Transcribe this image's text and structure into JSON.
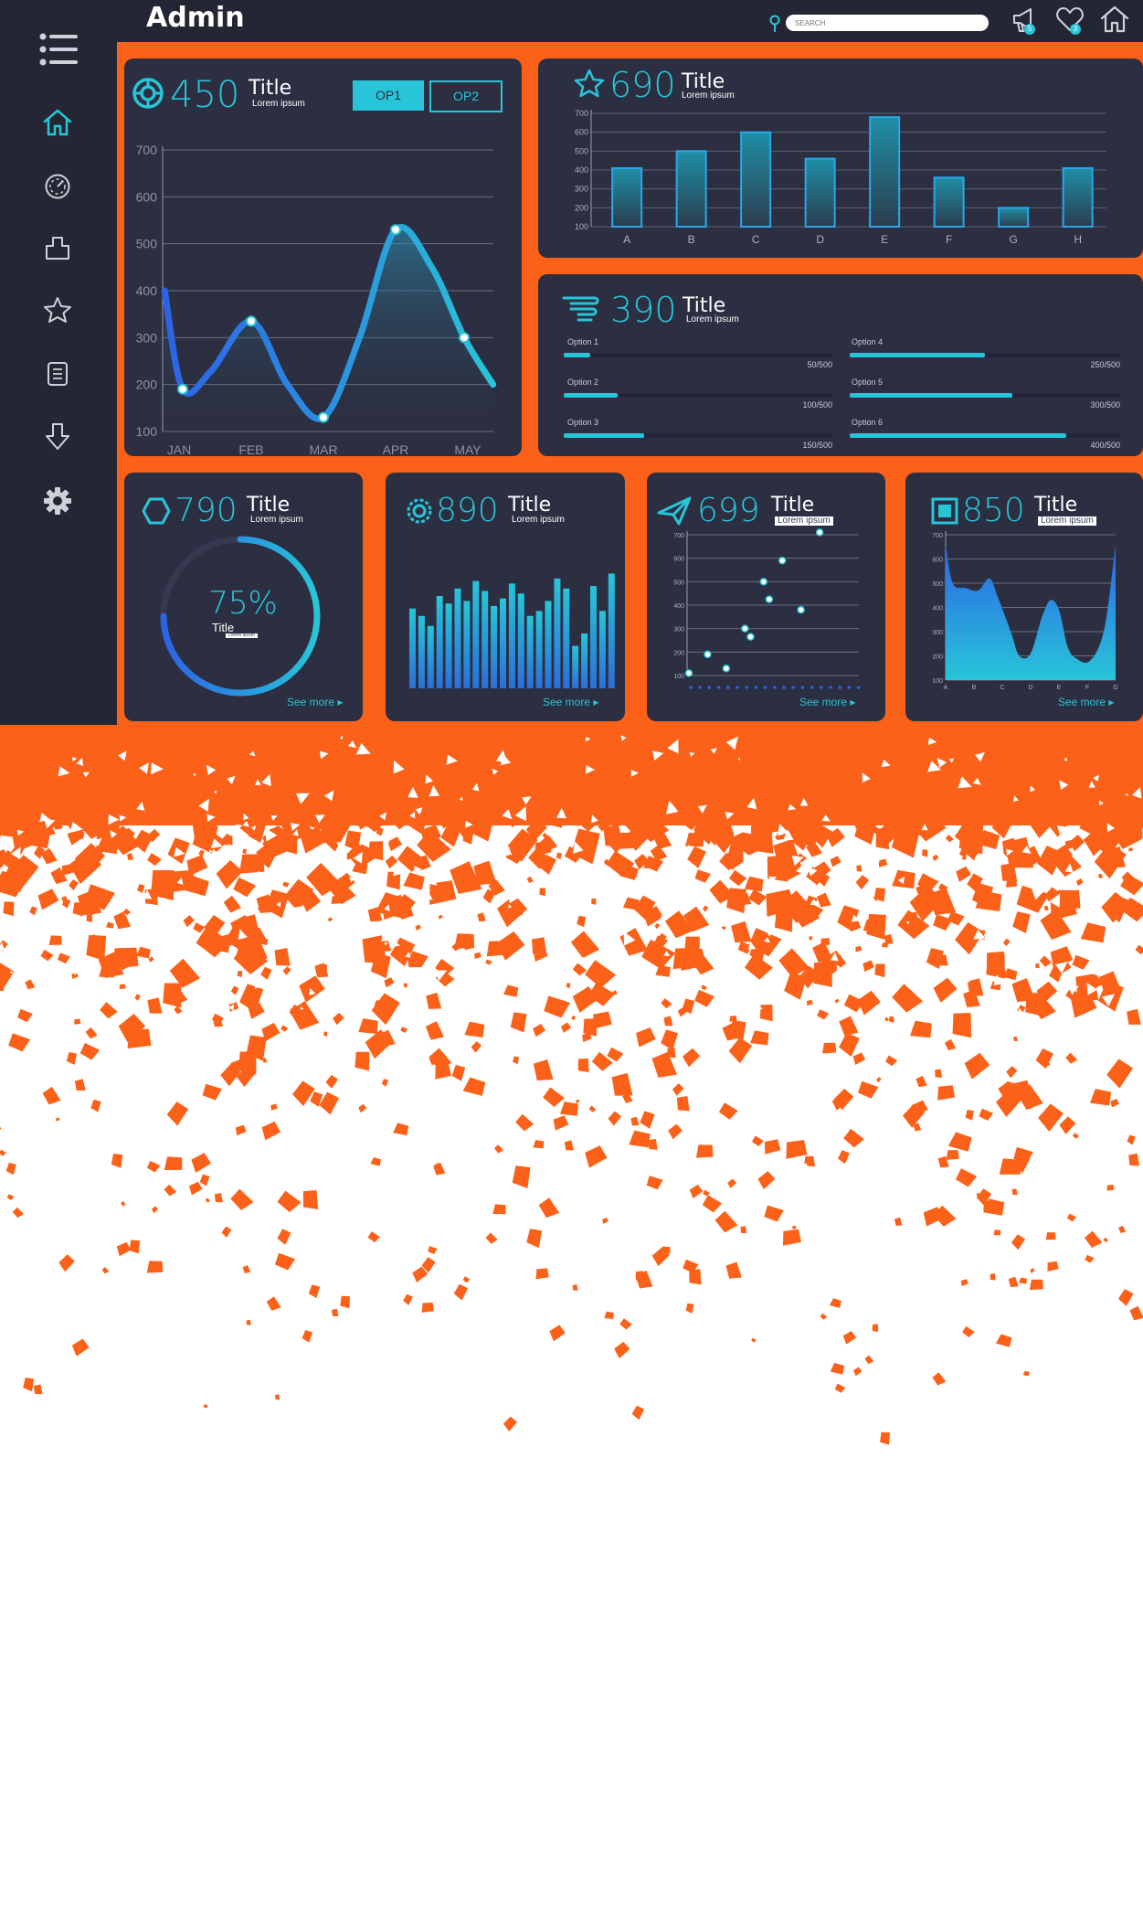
{
  "app": {
    "title": "Admin"
  },
  "colors": {
    "accent": "#28c5d8",
    "blue": "#2d63e6",
    "brand_orange": "#fb6118",
    "panel": "#2c2f42",
    "sidebar": "#242733"
  },
  "header": {
    "search_placeholder": "SEARCH",
    "icons": [
      "location-pin-icon",
      "megaphone-icon",
      "heart-icon",
      "home-icon"
    ],
    "notification_badges": [
      "5",
      "3"
    ]
  },
  "sidebar": {
    "menu_icon": "hamburger-menu-icon",
    "items": [
      {
        "icon": "home-icon",
        "active": true
      },
      {
        "icon": "dashboard-icon",
        "active": false
      },
      {
        "icon": "box-icon",
        "active": false
      },
      {
        "icon": "star-icon",
        "active": false
      },
      {
        "icon": "document-icon",
        "active": false
      },
      {
        "icon": "download-arrow-icon",
        "active": false
      },
      {
        "icon": "settings-gear-icon",
        "active": false
      }
    ]
  },
  "cards": {
    "line_card": {
      "value": "450",
      "title": "Title",
      "subtitle": "Lorem ipsum",
      "op1": "OP1",
      "op2": "OP2"
    },
    "bar_card": {
      "value": "690",
      "title": "Title",
      "subtitle": "Lorem ipsum"
    },
    "progress_card": {
      "value": "390",
      "title": "Title",
      "subtitle": "Lorem ipsum",
      "options": [
        {
          "label": "Option 1",
          "value": "50/500",
          "fraction": 0.1
        },
        {
          "label": "Option 2",
          "value": "100/500",
          "fraction": 0.2
        },
        {
          "label": "Option 3",
          "value": "150/500",
          "fraction": 0.3
        },
        {
          "label": "Option 4",
          "value": "250/500",
          "fraction": 0.5
        },
        {
          "label": "Option 5",
          "value": "300/500",
          "fraction": 0.6
        },
        {
          "label": "Option 6",
          "value": "400/500",
          "fraction": 0.8
        }
      ]
    },
    "donut_card": {
      "value": "790",
      "title": "Title",
      "subtitle": "Lorem ipsum",
      "percent_label": "75%",
      "inner_title": "Title",
      "inner_subtitle": "Lorem ipsum",
      "percent": 0.75,
      "see_more": "See more ▸"
    },
    "mini_bar_card": {
      "value": "890",
      "title": "Title",
      "subtitle": "Lorem ipsum",
      "see_more": "See more ▸"
    },
    "scatter_card": {
      "value": "699",
      "title": "Title",
      "subtitle": "Lorem ipsum",
      "see_more": "See more ▸"
    },
    "area_card": {
      "value": "850",
      "title": "Title",
      "subtitle": "Lorem ipsum",
      "see_more": "See more ▸"
    }
  },
  "chart_data": [
    {
      "type": "line",
      "x": [
        "JAN",
        "FEB",
        "MAR",
        "APR",
        "MAY"
      ],
      "y_ticks": [
        100,
        200,
        300,
        400,
        500,
        600,
        700
      ],
      "ylim": [
        100,
        700
      ],
      "points": [
        [
          0.05,
          190
        ],
        [
          1.0,
          335
        ],
        [
          2.0,
          130
        ],
        [
          3.0,
          530
        ],
        [
          3.95,
          300
        ]
      ],
      "curve": [
        [
          -0.2,
          400
        ],
        [
          0.05,
          190
        ],
        [
          0.45,
          230
        ],
        [
          1.0,
          335
        ],
        [
          1.5,
          200
        ],
        [
          2.0,
          130
        ],
        [
          2.5,
          300
        ],
        [
          3.0,
          530
        ],
        [
          3.5,
          450
        ],
        [
          3.95,
          300
        ],
        [
          4.35,
          200
        ]
      ]
    },
    {
      "type": "bar",
      "categories": [
        "A",
        "B",
        "C",
        "D",
        "E",
        "F",
        "G",
        "H"
      ],
      "values": [
        410,
        500,
        600,
        460,
        680,
        360,
        200,
        410
      ],
      "y_ticks": [
        100,
        200,
        300,
        400,
        500,
        600,
        700
      ],
      "ylim": [
        100,
        700
      ]
    },
    {
      "type": "bar",
      "values": [
        64,
        58,
        50,
        74,
        68,
        80,
        70,
        86,
        78,
        66,
        72,
        84,
        76,
        58,
        62,
        70,
        88,
        80,
        34,
        44,
        82,
        62,
        92
      ]
    },
    {
      "type": "scatter",
      "y_ticks": [
        100,
        200,
        300,
        400,
        500,
        600,
        700
      ],
      "ylim": [
        100,
        700
      ],
      "points": [
        [
          0,
          110
        ],
        [
          1,
          190
        ],
        [
          2,
          130
        ],
        [
          3,
          300
        ],
        [
          3.3,
          265
        ],
        [
          4,
          500
        ],
        [
          4.3,
          425
        ],
        [
          5,
          590
        ],
        [
          6,
          380
        ],
        [
          7,
          710
        ]
      ],
      "xlim": [
        0,
        9
      ]
    },
    {
      "type": "area",
      "categories": [
        "A",
        "B",
        "C",
        "D",
        "E",
        "F",
        "G"
      ],
      "y_ticks": [
        100,
        200,
        300,
        400,
        500,
        600,
        700
      ],
      "ylim": [
        100,
        700
      ],
      "curve": [
        [
          0,
          660
        ],
        [
          0.25,
          500
        ],
        [
          0.7,
          480
        ],
        [
          1.15,
          470
        ],
        [
          1.55,
          520
        ],
        [
          1.85,
          440
        ],
        [
          2.3,
          300
        ],
        [
          2.6,
          200
        ],
        [
          3.0,
          210
        ],
        [
          3.4,
          360
        ],
        [
          3.7,
          430
        ],
        [
          4.0,
          390
        ],
        [
          4.3,
          240
        ],
        [
          4.6,
          190
        ],
        [
          5.1,
          180
        ],
        [
          5.6,
          310
        ],
        [
          6.0,
          660
        ]
      ]
    }
  ]
}
